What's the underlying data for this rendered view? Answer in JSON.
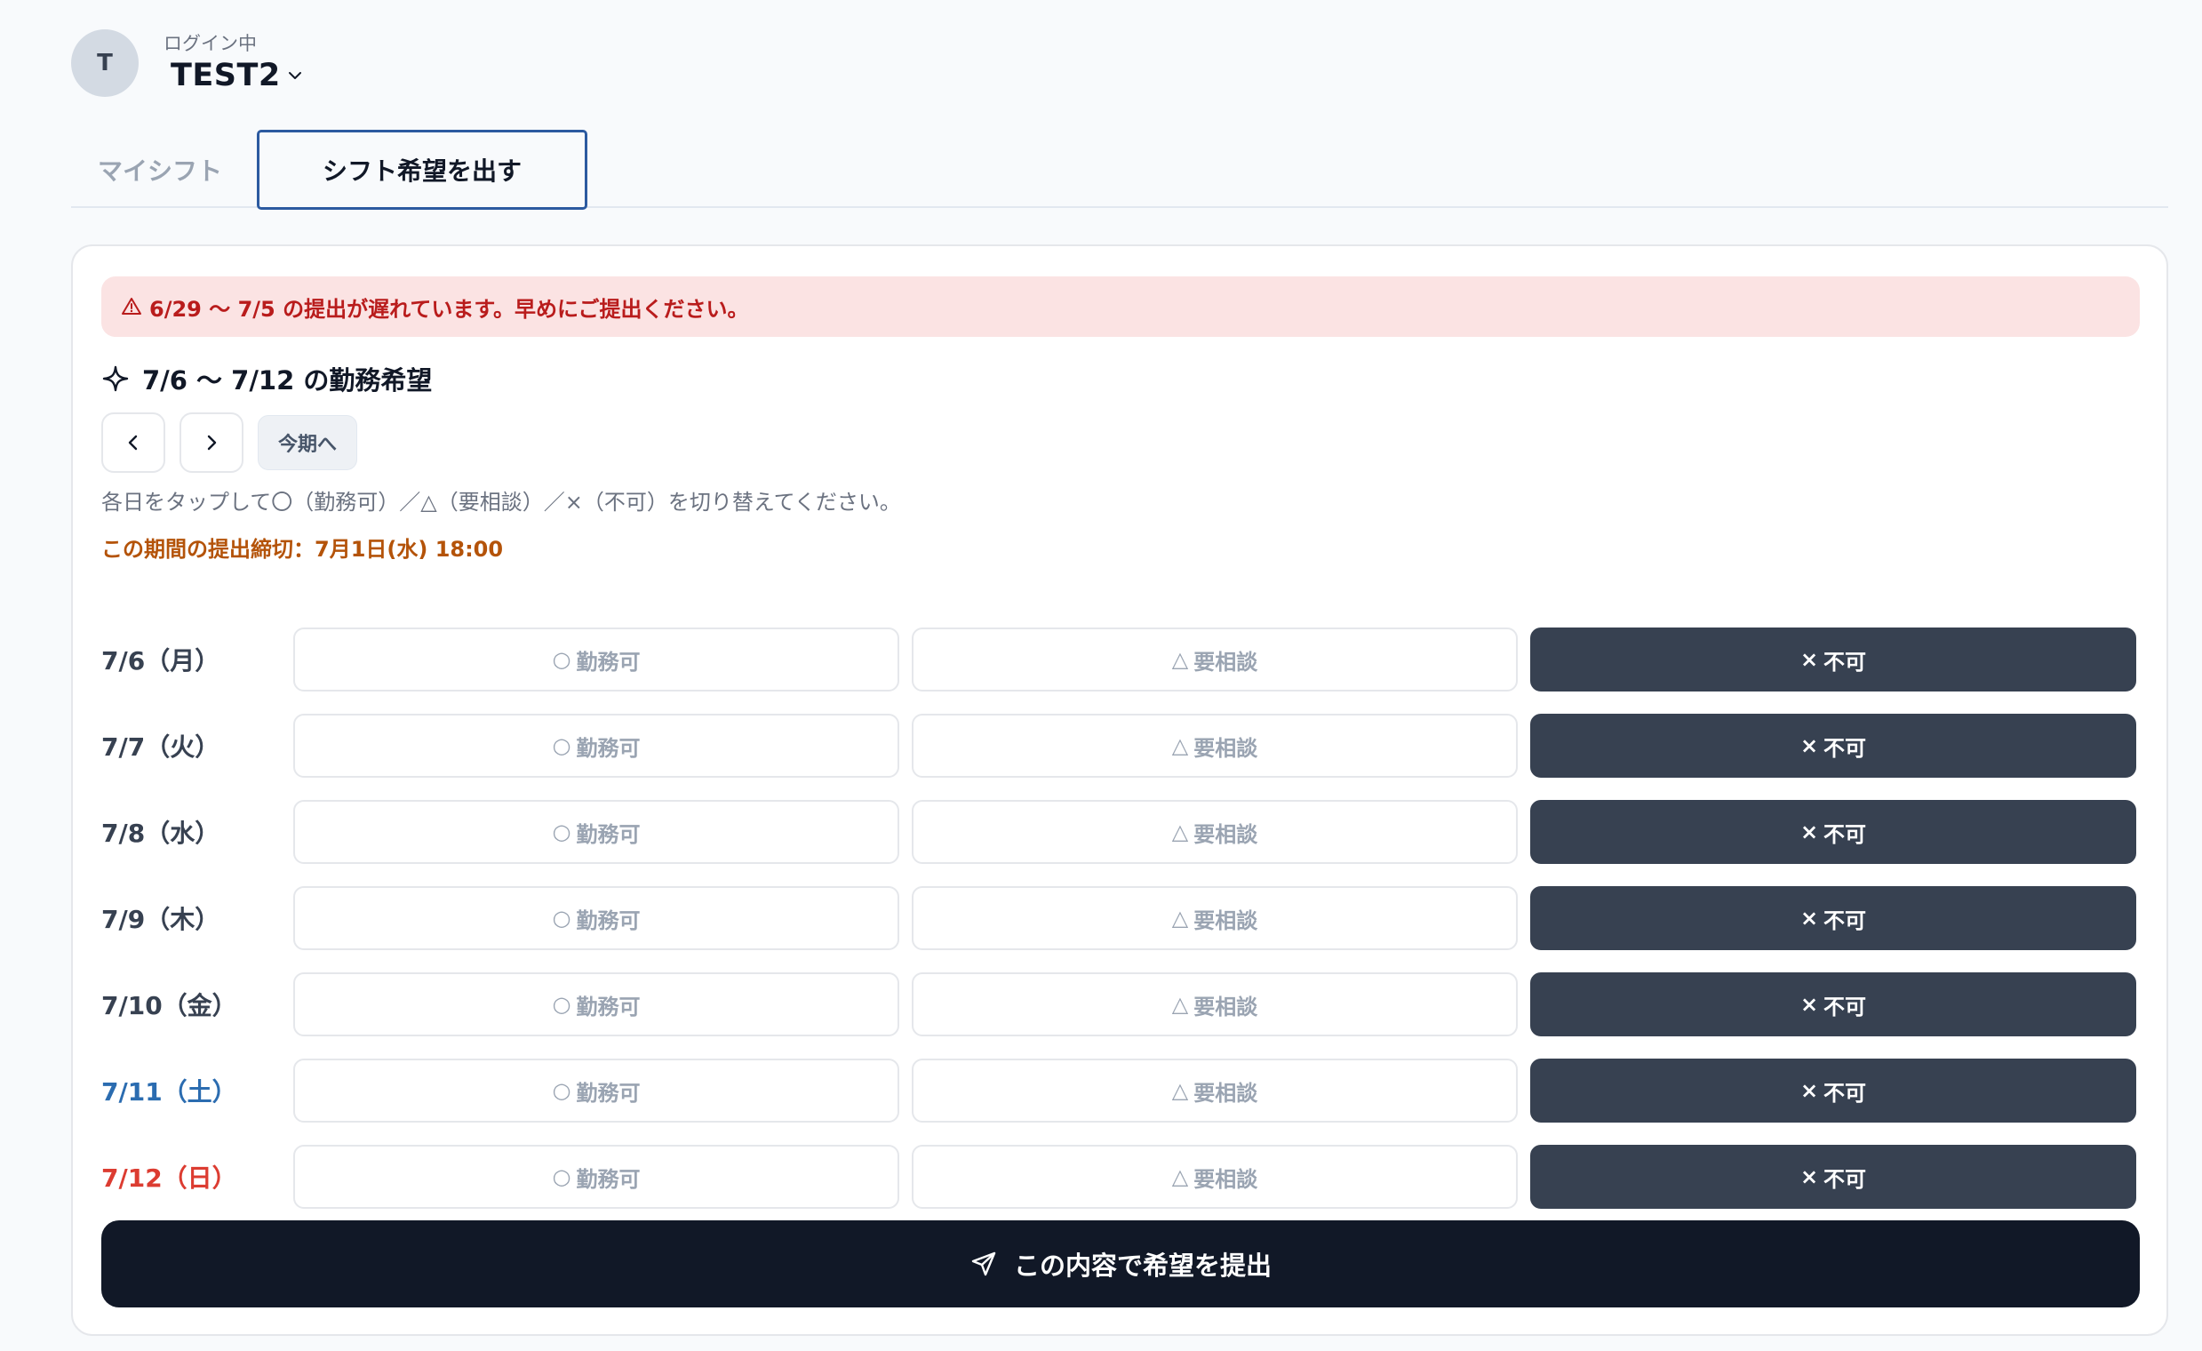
{
  "user": {
    "avatar_initial": "T",
    "login_label": "ログイン中",
    "name": "TEST2"
  },
  "tabs": [
    {
      "label": "マイシフト",
      "active": false
    },
    {
      "label": "シフト希望を出す",
      "active": true
    }
  ],
  "alert": {
    "text": "6/29 〜 7/5 の提出が遅れています。早めにご提出ください。",
    "icon": "warning-triangle-icon",
    "color": "#b91c1c"
  },
  "section": {
    "title": "7/6 〜 7/12 の勤務希望",
    "icon": "sparkle-icon"
  },
  "nav": {
    "prev_icon": "chevron-left-icon",
    "next_icon": "chevron-right-icon",
    "today_label": "今期へ"
  },
  "instructions": "各日をタップして〇（勤務可）／△（要相談）／×（不可）を切り替えてください。",
  "deadline": "この期間の提出締切：7月1日(水) 18:00",
  "options": {
    "ok": {
      "glyph": "○",
      "label": "勤務可"
    },
    "consult": {
      "glyph": "△",
      "label": "要相談"
    },
    "ng": {
      "glyph": "×",
      "label": "不可"
    }
  },
  "days": [
    {
      "label": "7/6（月）",
      "selected": "ng",
      "type": "weekday"
    },
    {
      "label": "7/7（火）",
      "selected": "ng",
      "type": "weekday"
    },
    {
      "label": "7/8（水）",
      "selected": "ng",
      "type": "weekday"
    },
    {
      "label": "7/9（木）",
      "selected": "ng",
      "type": "weekday"
    },
    {
      "label": "7/10（金）",
      "selected": "ng",
      "type": "weekday"
    },
    {
      "label": "7/11（土）",
      "selected": "ng",
      "type": "saturday"
    },
    {
      "label": "7/12（日）",
      "selected": "ng",
      "type": "sunday"
    }
  ],
  "submit": {
    "label": "この内容で希望を提出",
    "icon": "send-icon"
  },
  "colors": {
    "selected_bg": "#374151",
    "submit_bg": "#111827",
    "saturday": "#2b6cb0",
    "sunday": "#dc3c31",
    "deadline": "#b45309",
    "tab_active_border": "#2c5aa0"
  }
}
